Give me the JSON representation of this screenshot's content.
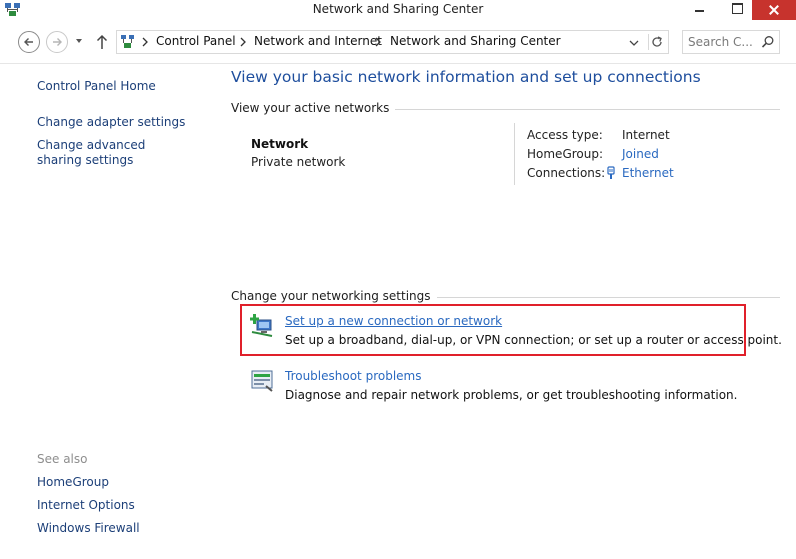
{
  "window": {
    "title": "Network and Sharing Center"
  },
  "navigation": {
    "breadcrumbs": [
      "Control Panel",
      "Network and Internet",
      "Network and Sharing Center"
    ],
    "search_placeholder": "Search C..."
  },
  "sidebar": {
    "links": [
      "Control Panel Home",
      "Change adapter settings",
      "Change advanced sharing settings"
    ],
    "see_also_label": "See also",
    "see_also_links": [
      "HomeGroup",
      "Internet Options",
      "Windows Firewall"
    ]
  },
  "main": {
    "title": "View your basic network information and set up connections",
    "active_networks_heading": "View your active networks",
    "network": {
      "name": "Network",
      "type": "Private network",
      "properties": [
        {
          "label": "Access type:",
          "value": "Internet"
        },
        {
          "label": "HomeGroup:",
          "value": "Joined"
        },
        {
          "label": "Connections:",
          "value": "Ethernet"
        }
      ]
    },
    "settings_heading": "Change your networking settings",
    "tasks": [
      {
        "link": "Set up a new connection or network",
        "description": "Set up a broadband, dial-up, or VPN connection; or set up a router or access point."
      },
      {
        "link": "Troubleshoot problems",
        "description": "Diagnose and repair network problems, or get troubleshooting information."
      }
    ]
  },
  "colors": {
    "link": "#2a69c0",
    "title": "#1e4e9d",
    "highlight": "#e0202a",
    "close_button": "#c7332d"
  }
}
